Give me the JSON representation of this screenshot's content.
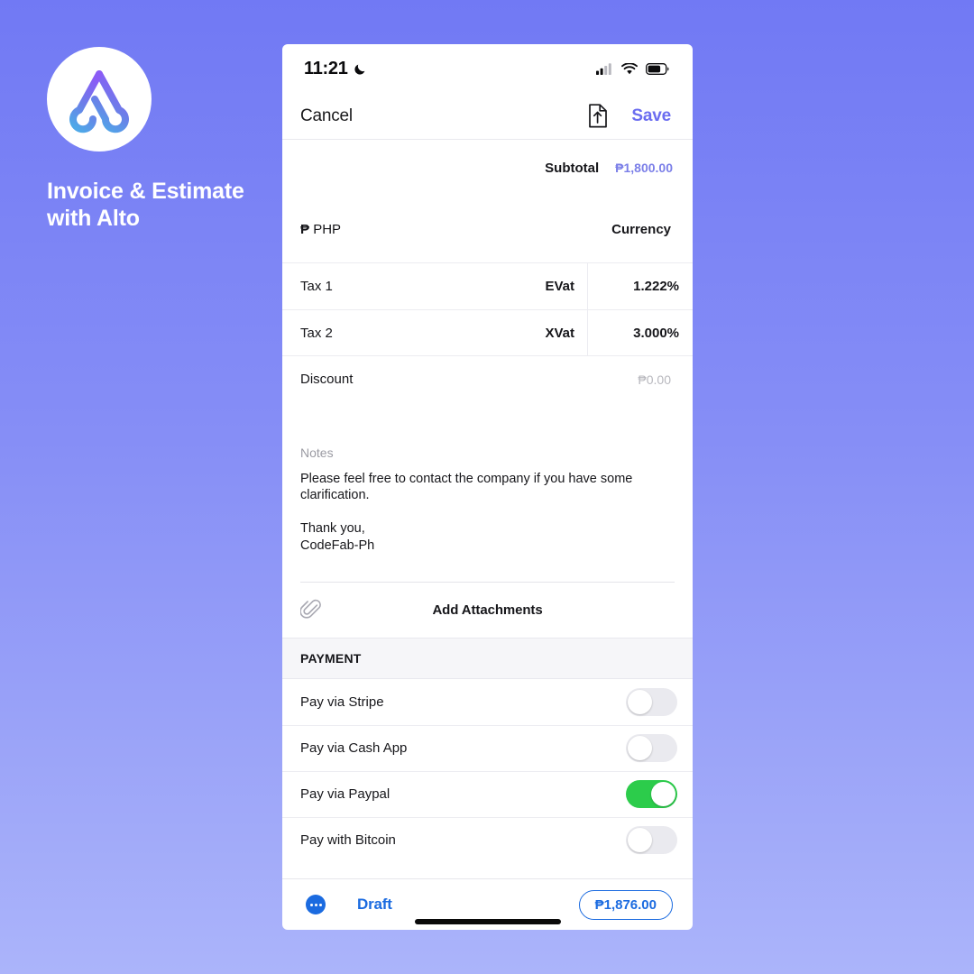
{
  "branding": {
    "logo_icon": "alto-a-logo",
    "title": "Invoice & Estimate\nwith Alto",
    "logo_gradient_from": "#8B5CF6",
    "logo_gradient_to": "#4FA8E8",
    "background_from": "#7179F4",
    "background_to": "#ABB4FA"
  },
  "status_bar": {
    "time": "11:21",
    "moon_icon": "crescent-moon-icon",
    "signal_icon": "cellular-signal-icon",
    "wifi_icon": "wifi-icon",
    "battery_icon": "battery-icon"
  },
  "nav_bar": {
    "cancel_label": "Cancel",
    "share_icon": "document-export-icon",
    "save_label": "Save",
    "accent_color": "#6B6DF0"
  },
  "summary": {
    "subtotal_label": "Subtotal",
    "subtotal_value": "₱1,800.00",
    "currency_symbol": "₱",
    "currency_code": "PHP",
    "currency_label": "Currency"
  },
  "taxes": [
    {
      "name": "Tax 1",
      "type": "EVat",
      "rate": "1.222%"
    },
    {
      "name": "Tax 2",
      "type": "XVat",
      "rate": "3.000%"
    }
  ],
  "discount": {
    "label": "Discount",
    "value": "₱0.00"
  },
  "notes": {
    "label": "Notes",
    "body": "Please feel free to contact the company if you have some clarification.",
    "signature": "Thank you,\nCodeFab-Ph"
  },
  "attachments": {
    "icon": "paperclip-icon",
    "label": "Add Attachments"
  },
  "payment": {
    "section_title": "PAYMENT",
    "on_color": "#2CCC4B",
    "methods": [
      {
        "label": "Pay via Stripe",
        "enabled": false
      },
      {
        "label": "Pay via Cash App",
        "enabled": false
      },
      {
        "label": "Pay via Paypal",
        "enabled": true
      },
      {
        "label": "Pay with Bitcoin",
        "enabled": false
      }
    ]
  },
  "bottom_bar": {
    "more_icon": "more-options-icon",
    "status_label": "Draft",
    "total_value": "₱1,876.00",
    "accent_color": "#1B6BE0"
  }
}
